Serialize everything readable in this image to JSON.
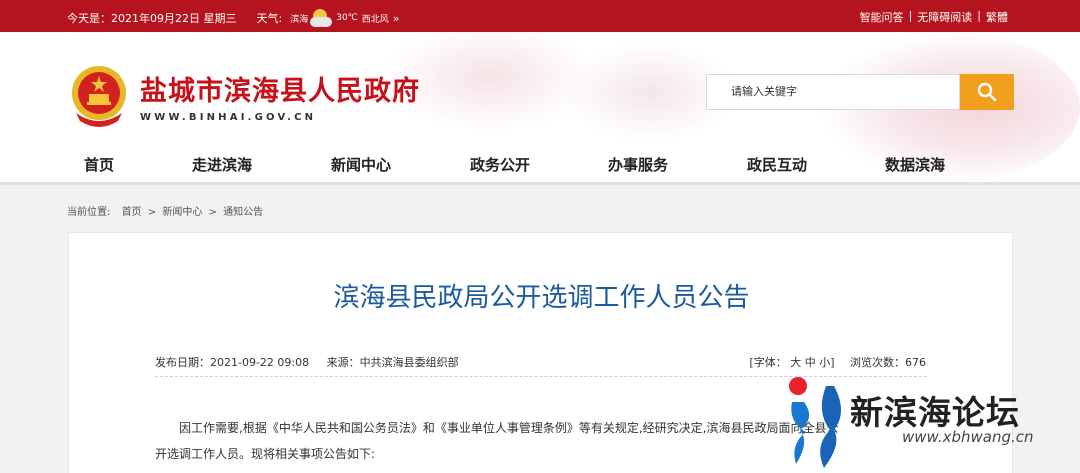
{
  "topbar": {
    "date": "今天是：2021年09月22日 星期三",
    "weather_label": "天气:",
    "weather_city": "滨海",
    "weather_temp": "30℃",
    "weather_wind": "西北风",
    "weather_more": "»",
    "links": [
      "智能问答",
      "无障碍阅读",
      "繁體"
    ],
    "sep": "|"
  },
  "header": {
    "site_title": "盐城市滨海县人民政府",
    "site_url": "WWW.BINHAI.GOV.CN",
    "search_placeholder": "请输入关键字",
    "nav": [
      "首页",
      "走进滨海",
      "新闻中心",
      "政务公开",
      "办事服务",
      "政民互动",
      "数据滨海"
    ]
  },
  "breadcrumb": {
    "label": "当前位置:",
    "items": [
      "首页",
      ">",
      "新闻中心",
      ">",
      "通知公告"
    ]
  },
  "article": {
    "title": "滨海县民政局公开选调工作人员公告",
    "publish_date": "发布日期：2021-09-22 09:08",
    "source": "来源：中共滨海县委组织部",
    "font_label": "[字体：",
    "font_large": "大",
    "font_medium": "中",
    "font_small": "小",
    "font_close": "]",
    "views": "浏览次数：676",
    "paragraph_1": "因工作需要,根据《中华人民共和国公务员法》和《事业单位人事管理条例》等有关规定,经研究决定,滨海县民政局面向全县公",
    "paragraph_2": "开选调工作人员。现将相关事项公告如下:"
  },
  "watermark": {
    "text": "新滨海论坛",
    "url": "www.xbhwang.cn"
  },
  "colors": {
    "topbar": "#b5131d",
    "title_red": "#c8101a",
    "article_title_blue": "#1a5a9e",
    "search_button": "#f0a01c"
  }
}
